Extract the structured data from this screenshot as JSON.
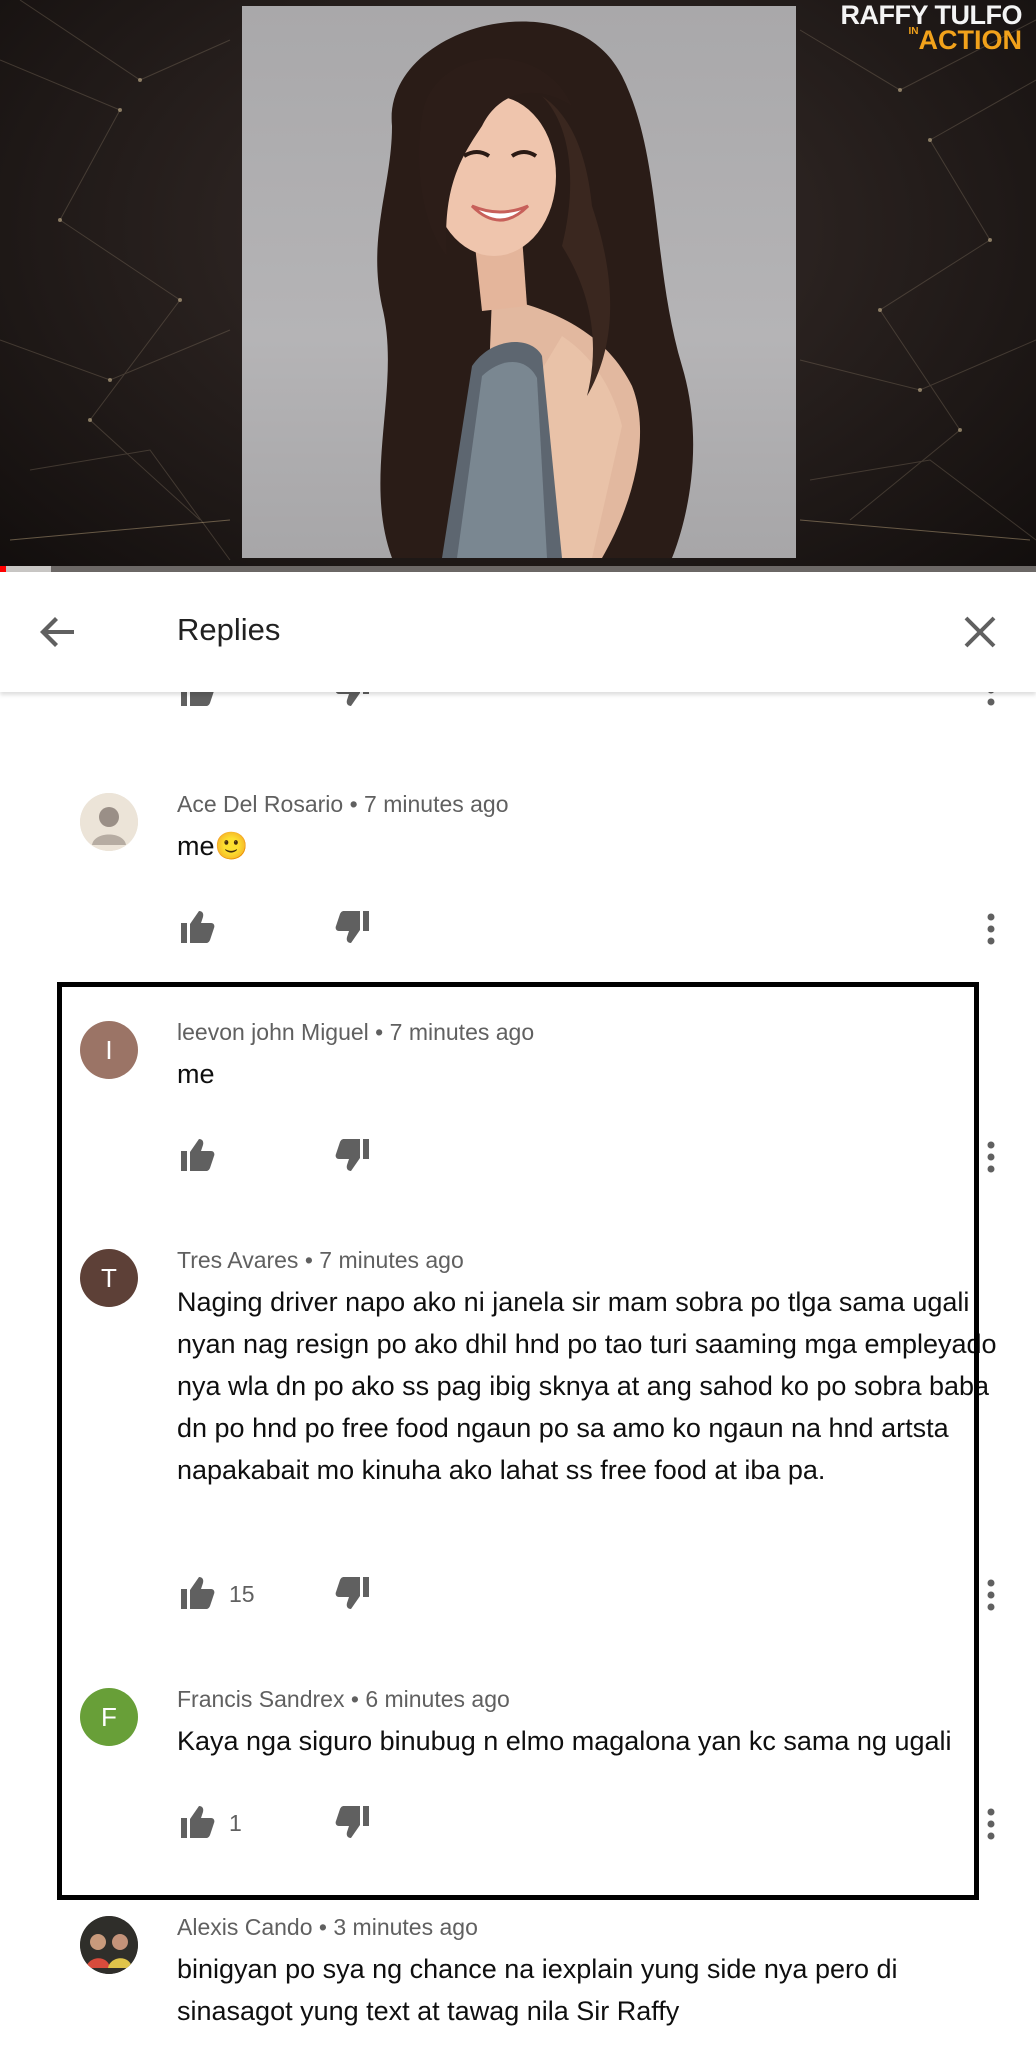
{
  "video": {
    "channel_logo_line1": "RAFFY TULFO",
    "channel_logo_small": "IN",
    "channel_logo_line2": "ACTION",
    "progress_percent": 0.6,
    "buffered_percent": 4.9
  },
  "header": {
    "title": "Replies",
    "back_icon": "arrow-back-icon",
    "close_icon": "close-icon"
  },
  "comments": [
    {
      "author": "Ace Del Rosario",
      "time": "7 minutes ago",
      "text": "me🙂",
      "likes": "",
      "avatar_letter": "",
      "avatar_color": "#d9cfc2"
    },
    {
      "author": "leevon john Miguel",
      "time": "7 minutes ago",
      "text": "me",
      "likes": "",
      "avatar_letter": "I",
      "avatar_color": "#9b7466"
    },
    {
      "author": "Tres Avares",
      "time": "7 minutes ago",
      "text": "Naging driver napo ako ni janela sir mam sobra po tlga sama ugali nyan nag resign po ako dhil hnd po tao turi saaming mga empleyado nya wla dn po ako ss pag ibig sknya at ang sahod ko po sobra baba dn po hnd po free food ngaun po sa amo ko ngaun na hnd artsta napakabait mo kinuha ako lahat ss free food at iba pa.",
      "likes": "15",
      "avatar_letter": "T",
      "avatar_color": "#5d4037"
    },
    {
      "author": "Francis Sandrex",
      "time": "6 minutes ago",
      "text": "Kaya nga siguro binubug n elmo magalona yan kc  sama ng ugali",
      "likes": "1",
      "avatar_letter": "F",
      "avatar_color": "#689f38"
    },
    {
      "author": "Alexis Cando",
      "time": "3 minutes ago",
      "text": "binigyan po sya ng chance na iexplain yung side nya pero di sinasagot yung text at tawag nila Sir Raffy",
      "likes": "",
      "avatar_letter": "",
      "avatar_color": "#3b3a36"
    }
  ],
  "icons": {
    "like": "thumb-up-icon",
    "dislike": "thumb-down-icon",
    "more": "more-vert-icon"
  },
  "colors": {
    "meta_text": "#606060",
    "icon_gray": "#606060",
    "progress_played": "#ff0000",
    "highlight_border": "#000000"
  }
}
